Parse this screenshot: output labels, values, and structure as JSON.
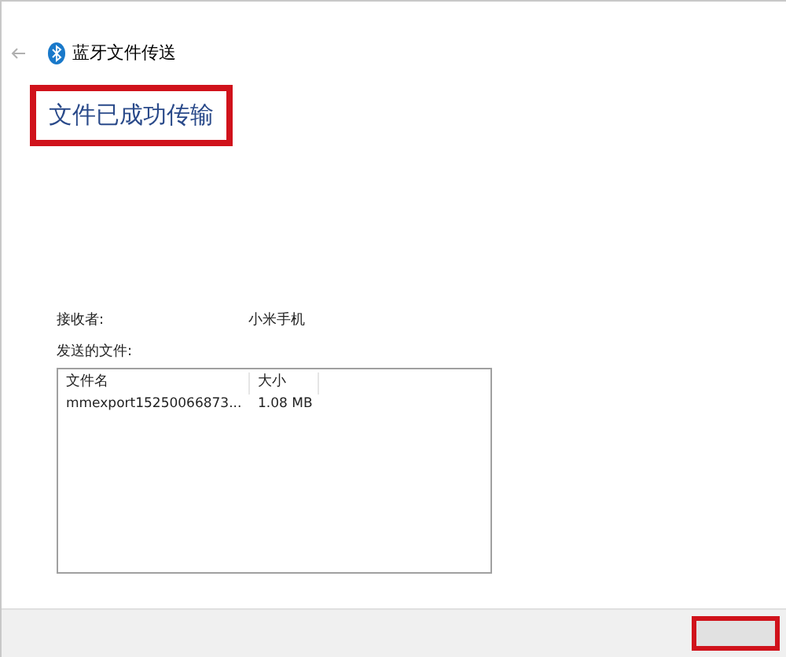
{
  "window": {
    "title": "蓝牙文件传送"
  },
  "heading": {
    "text": "文件已成功传输",
    "highlighted": true
  },
  "details": [
    {
      "label": "接收者:",
      "value": "小米手机"
    }
  ],
  "files_label": "发送的文件:",
  "file_list": {
    "columns": [
      "文件名",
      "大小"
    ],
    "rows": [
      [
        "mmexport15250066873...",
        "1.08 MB"
      ]
    ]
  },
  "footer": {
    "button": {
      "highlighted": true
    }
  }
}
